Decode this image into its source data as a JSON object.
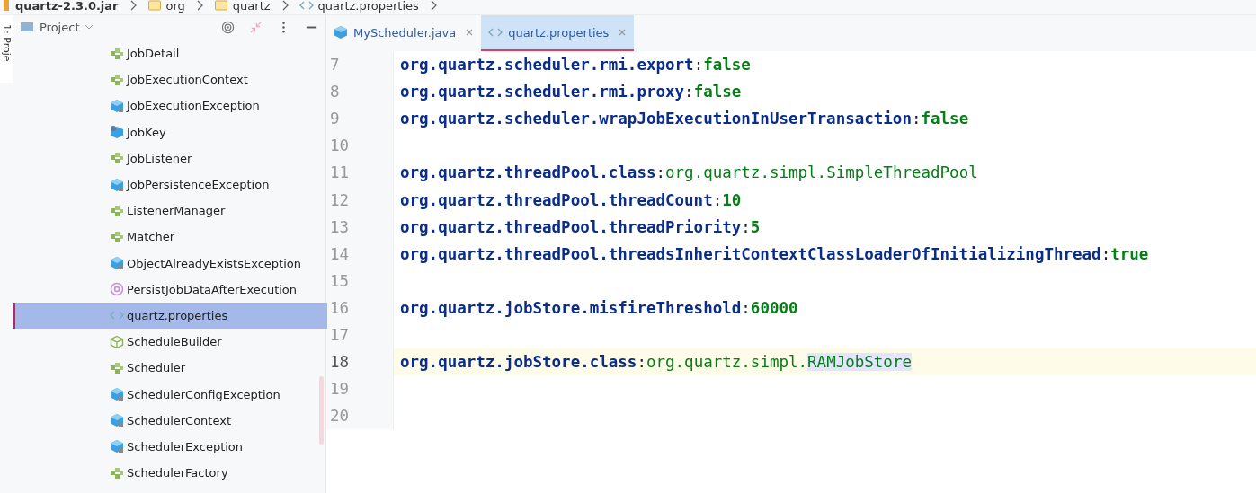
{
  "breadcrumb": [
    {
      "label": "quartz-2.3.0.jar",
      "kind": "jar"
    },
    {
      "label": "org",
      "kind": "folder"
    },
    {
      "label": "quartz",
      "kind": "folder"
    },
    {
      "label": "quartz.properties",
      "kind": "properties"
    }
  ],
  "side_strip": {
    "label": "1: Proje"
  },
  "project_panel": {
    "title": "Project",
    "items": [
      {
        "label": "JobDetail",
        "kind": "interface",
        "selected": false
      },
      {
        "label": "JobExecutionContext",
        "kind": "interface",
        "selected": false
      },
      {
        "label": "JobExecutionException",
        "kind": "class",
        "selected": false
      },
      {
        "label": "JobKey",
        "kind": "key",
        "selected": false
      },
      {
        "label": "JobListener",
        "kind": "interface",
        "selected": false
      },
      {
        "label": "JobPersistenceException",
        "kind": "class",
        "selected": false
      },
      {
        "label": "ListenerManager",
        "kind": "interface",
        "selected": false
      },
      {
        "label": "Matcher",
        "kind": "interface",
        "selected": false
      },
      {
        "label": "ObjectAlreadyExistsException",
        "kind": "class",
        "selected": false
      },
      {
        "label": "PersistJobDataAfterExecution",
        "kind": "annotation",
        "selected": false
      },
      {
        "label": "quartz.properties",
        "kind": "properties",
        "selected": true
      },
      {
        "label": "ScheduleBuilder",
        "kind": "builder",
        "selected": false
      },
      {
        "label": "Scheduler",
        "kind": "interface",
        "selected": false
      },
      {
        "label": "SchedulerConfigException",
        "kind": "class",
        "selected": false
      },
      {
        "label": "SchedulerContext",
        "kind": "class",
        "selected": false
      },
      {
        "label": "SchedulerException",
        "kind": "class",
        "selected": false
      },
      {
        "label": "SchedulerFactory",
        "kind": "interface",
        "selected": false
      }
    ]
  },
  "tabs": [
    {
      "label": "MyScheduler.java",
      "kind": "java",
      "selected": false
    },
    {
      "label": "quartz.properties",
      "kind": "properties",
      "selected": true
    }
  ],
  "editor": {
    "lines": [
      {
        "number": "7",
        "key": "org.quartz.scheduler.rmi.export",
        "separator": ":",
        "value": "false",
        "literal": true,
        "current": false
      },
      {
        "number": "8",
        "key": "org.quartz.scheduler.rmi.proxy",
        "separator": ":",
        "value": "false",
        "literal": true,
        "current": false
      },
      {
        "number": "9",
        "key": "org.quartz.scheduler.wrapJobExecutionInUserTransaction",
        "separator": ":",
        "value": "false",
        "literal": true,
        "current": false
      },
      {
        "number": "10",
        "current": false
      },
      {
        "number": "11",
        "key": "org.quartz.threadPool.class",
        "separator": ":",
        "value": "org.quartz.simpl.SimpleThreadPool",
        "literal": false,
        "current": false
      },
      {
        "number": "12",
        "key": "org.quartz.threadPool.threadCount",
        "separator": ":",
        "value": "10",
        "literal": true,
        "current": false
      },
      {
        "number": "13",
        "key": "org.quartz.threadPool.threadPriority",
        "separator": ":",
        "value": "5",
        "literal": true,
        "current": false
      },
      {
        "number": "14",
        "key": "org.quartz.threadPool.threadsInheritContextClassLoaderOfInitializingThread",
        "separator": ":",
        "value": "true",
        "literal": true,
        "current": false
      },
      {
        "number": "15",
        "current": false
      },
      {
        "number": "16",
        "key": "org.quartz.jobStore.misfireThreshold",
        "separator": ":",
        "value": "60000",
        "literal": true,
        "current": false
      },
      {
        "number": "17",
        "current": false
      },
      {
        "number": "18",
        "key": "org.quartz.jobStore.class",
        "separator": ":",
        "value": "org.quartz.simpl.",
        "highlighted": "RAMJobStore",
        "literal": false,
        "current": true
      },
      {
        "number": "19",
        "current": false
      },
      {
        "number": "20",
        "current": false
      }
    ]
  }
}
